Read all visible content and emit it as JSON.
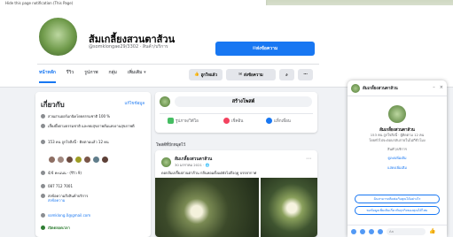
{
  "banner_text": "Hide this page notification (This Page)",
  "page": {
    "name": "ส้มเกลี้ยงสวนตาส้วน",
    "handle_category": "@somklongae29/3302 · สินค้า/บริการ",
    "send_message": "ส่งข้อความ"
  },
  "tabs": [
    "หน้าหลัก",
    "รีวิว",
    "รูปภาพ",
    "กลุ่ม",
    "เพิ่มเติม ▾"
  ],
  "actions": {
    "like": "ถูกใจแล้ว",
    "message": "ส่งข้อความ",
    "search_icon": "search-icon",
    "more_icon": "more-icon"
  },
  "intro": {
    "title": "เกี่ยวกับ",
    "edit": "แก้ไขข้อมูล",
    "rows": [
      "สวนผ่านออร์แกนิคโดยธรรมชาติ 100 %",
      "เลี้ยงผึ้งตามธรรมชาติ และพบสุขภาพส้มแห่งงานสุขภาพดี",
      "153 คน ถูกใจสิ่งนี้ · ติดตามแล้ว 12 คน",
      "4/4 คะแนน · (รีวิว 9)",
      "087 712 7001",
      "ส่งข้อความถึงสินค้าบริการ",
      "somklong.0@gmail.com",
      "เปิดตลอดเวลา"
    ],
    "messenger_link": "ส่งข้อความ",
    "friend_colors": [
      "#8d6e63",
      "#a1887f",
      "#6d4c41",
      "#9e9d24",
      "#795548",
      "#607d8b",
      "#5d4037"
    ]
  },
  "create_post": {
    "title": "สร้างโพสต์",
    "options": [
      "รูปภาพ/วิดีโอ",
      "เช็คอิน",
      "แท็กเพื่อน"
    ]
  },
  "post": {
    "section": "โพสต์ที่ปักหมุดไว้",
    "author": "ส้มเกลี้ยงสวนตาส้วน",
    "date": "30 มกราคม 2021 · 🌐",
    "text": "ดอกส้มเกลี้ยงสวนตาส้วน กลิ่นหอมตั้งแต่ยังไม่ถึงฤดู บรรยากาศ"
  },
  "chat": {
    "name": "ส้มเกลี้ยงสวนตาส้วน",
    "title": "ส้มเกลี้ยงสวนตาส้วน",
    "info1": "153 คน ถูกใจสิ่งนี้ · ผู้ติดตาม 12 คน",
    "info2": "โดยทั่วไปจะตอบกลับภายในไม่กี่ชั่วโมง",
    "category": "สินค้า/บริการ",
    "link1": "ดูเพจเพิ่มเติม",
    "link2": "แสดงเพิ่มเติม",
    "quick1": "ฉันสามารถติดต่อกับคุณได้อย่างไร",
    "quick2": "ขอข้อมูลเพิ่มเติมเกี่ยวกับธุรกิจของคุณได้ไหม",
    "input_placeholder": "Aa"
  }
}
